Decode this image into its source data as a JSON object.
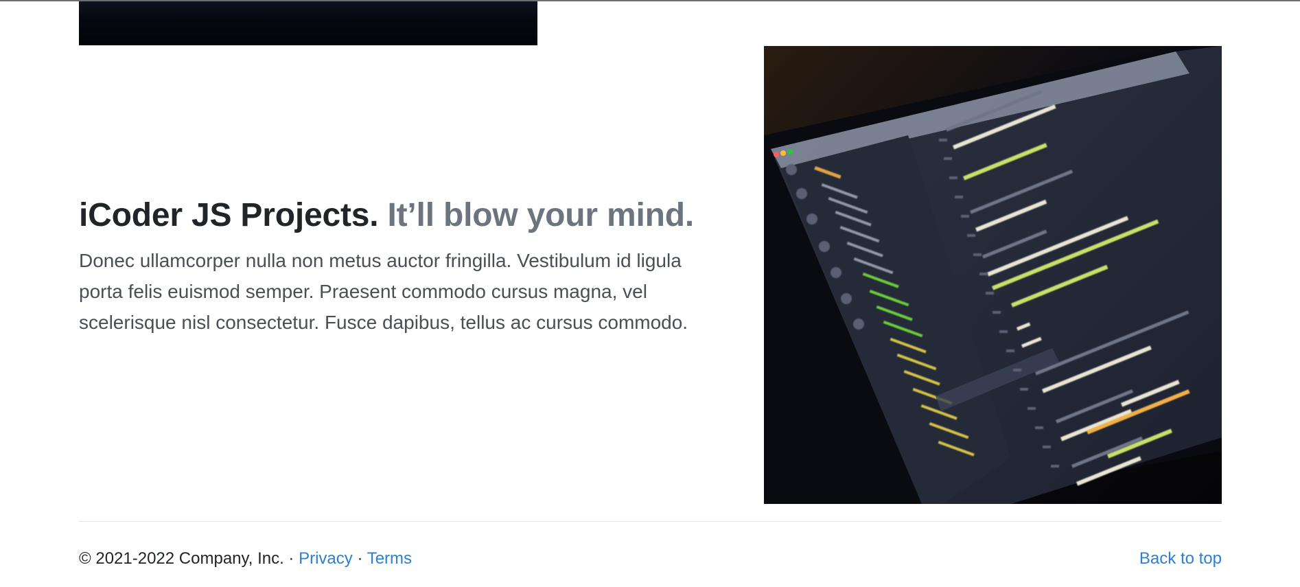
{
  "feature": {
    "heading_main": "iCoder JS Projects.",
    "heading_muted": "It’ll blow your mind.",
    "lead": "Donec ullamcorper nulla non metus auctor fringilla. Vestibulum id ligula porta felis euismod semper. Praesent commodo cursus magna, vel scelerisque nisl consectetur. Fusce dapibus, tellus ac cursus commodo."
  },
  "footer": {
    "copyright": "© 2021-2022 Company, Inc.",
    "separator": "·",
    "privacy_label": "Privacy",
    "terms_label": "Terms",
    "back_to_top_label": "Back to top"
  },
  "colors": {
    "heading": "#212529",
    "muted": "#6c757d",
    "link": "#2f7ed0"
  }
}
